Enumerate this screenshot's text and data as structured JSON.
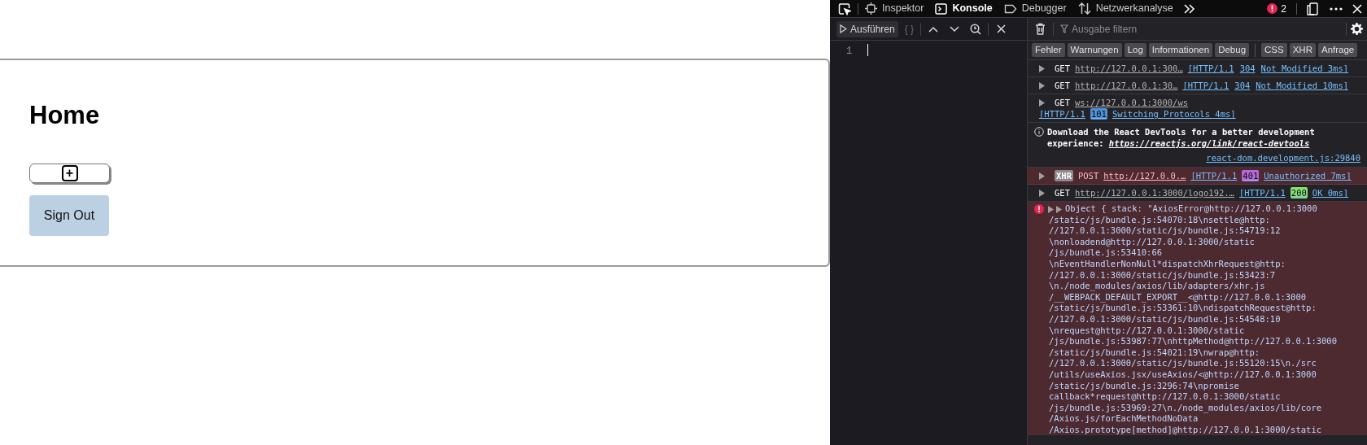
{
  "page": {
    "heading": "Home",
    "add_button": "+",
    "sign_out": "Sign Out"
  },
  "devtools": {
    "tabs": [
      {
        "label": "Inspektor",
        "selected": false
      },
      {
        "label": "Konsole",
        "selected": true
      },
      {
        "label": "Debugger",
        "selected": false
      },
      {
        "label": "Netzwerkanalyse",
        "selected": false
      }
    ],
    "error_count": "2",
    "editor": {
      "run_button": "Ausführen",
      "pretty_button": "{ }",
      "line_number": "1"
    },
    "filter": {
      "placeholder": "Ausgabe filtern"
    },
    "filter_buttons": [
      "Fehler",
      "Warnungen",
      "Log",
      "Informationen",
      "Debug",
      "CSS",
      "XHR",
      "Anfrage"
    ],
    "messages": [
      {
        "kind": "request",
        "error": false,
        "method": "GET",
        "url": "http://127.0.0.1:300…",
        "protocol": "[HTTP/1.1",
        "code": "304",
        "status": "Not Modified 3ms]"
      },
      {
        "kind": "request",
        "error": false,
        "method": "GET",
        "url": "http://127.0.0.1:30…",
        "protocol": "[HTTP/1.1",
        "code": "304",
        "status": "Not Modified 10ms]"
      },
      {
        "kind": "request",
        "error": false,
        "method": "GET",
        "url": "ws://127.0.0.1:3000/ws",
        "protocol": "[HTTP/1.1",
        "code": "101",
        "color": "#4f8fd6",
        "status": "Switching Protocols 4ms]"
      },
      {
        "kind": "info",
        "text": "Download the React DevTools for a better development experience: ",
        "link": "https://reactjs.org/link/react-devtools",
        "source": "react-dom.development.js:29840"
      },
      {
        "kind": "request",
        "error": true,
        "tag": "XHR",
        "method": "POST",
        "url": "http://127.0.0.…",
        "protocol": "[HTTP/1.1",
        "code": "401",
        "color": "#b768d8",
        "status": "Unauthorized 7ms]"
      },
      {
        "kind": "request",
        "error": false,
        "method": "GET",
        "url": "http://127.0.0.1:3000/logo192.…",
        "protocol": "[HTTP/1.1",
        "code": "200",
        "color": "#86de74",
        "status": "OK 0ms]"
      },
      {
        "kind": "object",
        "lines": [
          "Object { stack: \"AxiosError@http://127.0.0.1:3000",
          "/static/js/bundle.js:54070:18\\nsettle@http:",
          "//127.0.0.1:3000/static/js/bundle.js:54719:12",
          "\\nonloadend@http://127.0.0.1:3000/static",
          "/js/bundle.js:53410:66",
          "\\nEventHandlerNonNull*dispatchXhrRequest@http:",
          "//127.0.0.1:3000/static/js/bundle.js:53423:7",
          "\\n./node_modules/axios/lib/adapters/xhr.js",
          "/__WEBPACK_DEFAULT_EXPORT__<@http://127.0.0.1:3000",
          "/static/js/bundle.js:53361:10\\ndispatchRequest@http:",
          "//127.0.0.1:3000/static/js/bundle.js:54548:10",
          "\\nrequest@http://127.0.0.1:3000/static",
          "/js/bundle.js:53987:77\\nhttpMethod@http://127.0.0.1:3000",
          "/static/js/bundle.js:54021:19\\nwrap@http:",
          "//127.0.0.1:3000/static/js/bundle.js:55120:15\\n./src",
          "/utils/useAxios.jsx/useAxios/<@http://127.0.0.1:3000",
          "/static/js/bundle.js:3296:74\\npromise",
          "callback*request@http://127.0.0.1:3000/static",
          "/js/bundle.js:53969:27\\n./node_modules/axios/lib/core",
          "/Axios.js/forEachMethodNoData",
          "/Axios.prototype[method]@http://127.0.0.1:3000/static"
        ]
      }
    ]
  }
}
